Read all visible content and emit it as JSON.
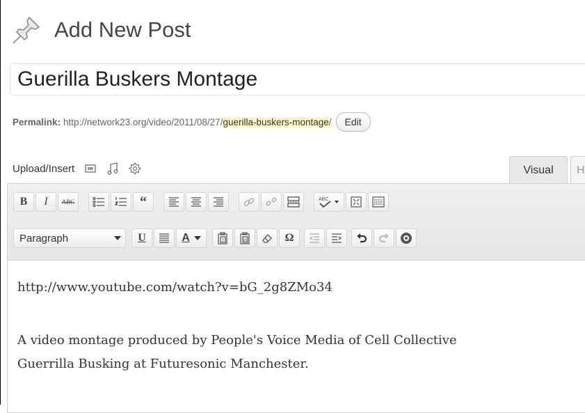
{
  "page": {
    "title": "Add New Post"
  },
  "post": {
    "title": "Guerilla Buskers Montage"
  },
  "permalink": {
    "label": "Permalink:",
    "base": "http://network23.org/video/2011/08/27/",
    "slug": "guerilla-buskers-montage",
    "trailing": "/",
    "edit_label": "Edit"
  },
  "media": {
    "label": "Upload/Insert",
    "icons": [
      "image-icon",
      "music-note-icon",
      "gear-icon"
    ]
  },
  "tabs": {
    "visual": "Visual",
    "html": "H"
  },
  "toolbar": {
    "bold": "B",
    "italic": "I",
    "strike": "ABC",
    "format_select": "Paragraph",
    "underline": "U",
    "text_color": "A",
    "omega": "Ω"
  },
  "content": {
    "line1": "http://www.youtube.com/watch?v=bG_2g8ZMo34",
    "line2": "A video montage produced by People's Voice Media of Cell Collective",
    "line3": "Guerrilla Busking at Futuresonic Manchester."
  },
  "colors": {
    "slug_highlight": "#fffbcc",
    "toolbar_bg": "#ececec",
    "text": "#333333"
  }
}
